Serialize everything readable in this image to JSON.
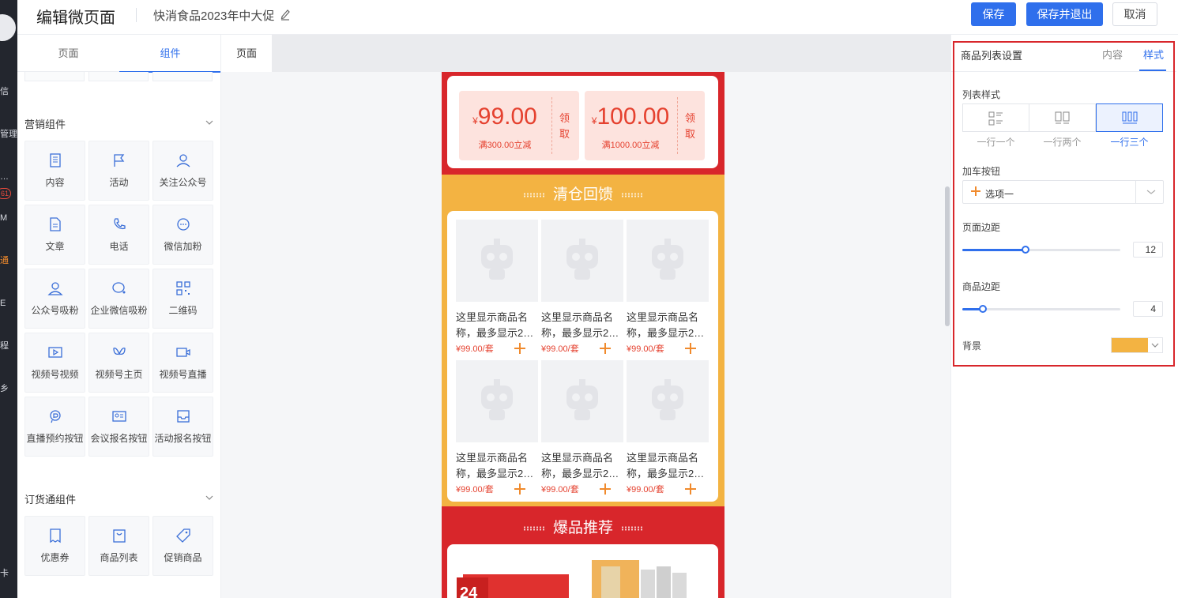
{
  "header": {
    "title": "编辑微页面",
    "subtitle": "快消食品2023年中大促",
    "save": "保存",
    "save_exit": "保存并退出",
    "cancel": "取消"
  },
  "rail": {
    "fragments": [
      "信",
      "管理",
      "…",
      "M",
      "通",
      "E",
      "程",
      "乡",
      "卡"
    ],
    "badge": "61"
  },
  "comp_panel": {
    "tabs": [
      "页面",
      "组件"
    ],
    "active_tab": "组件",
    "groups": [
      {
        "title": "营销组件",
        "items": [
          {
            "label": "内容",
            "icon": "document-icon"
          },
          {
            "label": "活动",
            "icon": "flag-icon"
          },
          {
            "label": "关注公众号",
            "icon": "user-follow-icon"
          },
          {
            "label": "文章",
            "icon": "article-icon"
          },
          {
            "label": "电话",
            "icon": "phone-icon"
          },
          {
            "label": "微信加粉",
            "icon": "chat-bubble-icon"
          },
          {
            "label": "公众号吸粉",
            "icon": "user-attract-icon"
          },
          {
            "label": "企业微信吸粉",
            "icon": "wecom-icon"
          },
          {
            "label": "二维码",
            "icon": "qrcode-icon"
          },
          {
            "label": "视频号视频",
            "icon": "video-icon"
          },
          {
            "label": "视频号主页",
            "icon": "channels-icon"
          },
          {
            "label": "视频号直播",
            "icon": "live-icon"
          },
          {
            "label": "直播预约按钮",
            "icon": "live-reserve-icon"
          },
          {
            "label": "会议报名按钮",
            "icon": "meeting-icon"
          },
          {
            "label": "活动报名按钮",
            "icon": "inbox-icon"
          }
        ]
      },
      {
        "title": "订货通组件",
        "items": [
          {
            "label": "优惠券",
            "icon": "coupon-icon"
          },
          {
            "label": "商品列表",
            "icon": "shopping-bag-icon"
          },
          {
            "label": "促销商品",
            "icon": "tag-icon"
          }
        ]
      }
    ]
  },
  "canvas": {
    "tab": "页面",
    "coupons": [
      {
        "currency": "¥",
        "amount": "99.00",
        "condition": "满300.00立减",
        "action": "领取"
      },
      {
        "currency": "¥",
        "amount": "100.00",
        "condition": "满1000.00立减",
        "action": "领取"
      }
    ],
    "section1_title": "清仓回馈",
    "section2_title": "爆品推荐",
    "products": [
      {
        "name": "这里显示商品名称，最多显示2…",
        "price": "¥99.00/套"
      },
      {
        "name": "这里显示商品名称，最多显示2…",
        "price": "¥99.00/套"
      },
      {
        "name": "这里显示商品名称，最多显示2…",
        "price": "¥99.00/套"
      },
      {
        "name": "这里显示商品名称，最多显示2…",
        "price": "¥99.00/套"
      },
      {
        "name": "这里显示商品名称，最多显示2…",
        "price": "¥99.00/套"
      },
      {
        "name": "这里显示商品名称，最多显示2…",
        "price": "¥99.00/套"
      }
    ],
    "banner_text": "24"
  },
  "settings": {
    "title": "商品列表设置",
    "tab_content": "内容",
    "tab_style": "样式",
    "active_tab": "样式",
    "list_style_label": "列表样式",
    "list_styles": [
      "一行一个",
      "一行两个",
      "一行三个"
    ],
    "list_style_selected": "一行三个",
    "cart_button_label": "加车按钮",
    "cart_button_value": "选项一",
    "page_margin_label": "页面边距",
    "page_margin_value": "12",
    "page_margin_fraction": 0.4,
    "item_margin_label": "商品边距",
    "item_margin_value": "4",
    "item_margin_fraction": 0.13,
    "background_label": "背景",
    "background_color": "#f3b342"
  },
  "colors": {
    "primary": "#2f6fec",
    "red": "#d8262b",
    "yellow": "#f3b342",
    "price": "#e5412f",
    "add_button": "#f08a2c"
  }
}
